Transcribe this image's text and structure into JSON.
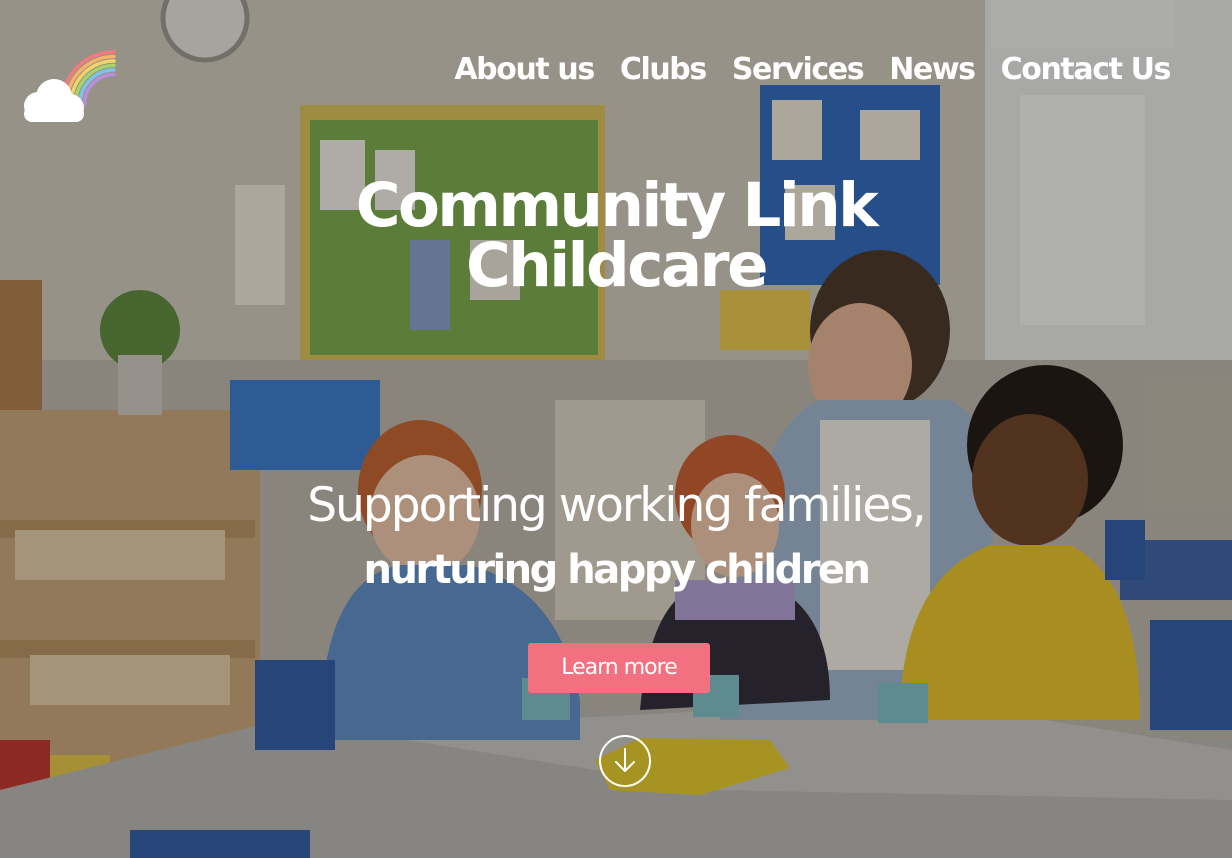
{
  "brand": {
    "logo_icon": "rainbow-cloud-icon",
    "rainbow_colors": [
      "#f07c7f",
      "#f5b36b",
      "#f2d56a",
      "#a6d46b",
      "#7ec4e8",
      "#b98fdc"
    ]
  },
  "nav": {
    "items": [
      {
        "label": "About us"
      },
      {
        "label": "Clubs"
      },
      {
        "label": "Services"
      },
      {
        "label": "News"
      },
      {
        "label": "Contact Us"
      }
    ]
  },
  "hero": {
    "title_line1": "Community Link",
    "title_line2": "Childcare",
    "tagline_line1": "Supporting working families,",
    "tagline_line2": "nurturing happy children",
    "cta_label": "Learn more",
    "cta_color": "#f2707f",
    "scroll_icon": "arrow-down-circle-icon",
    "background_image": "classroom-photo-teacher-and-children"
  }
}
